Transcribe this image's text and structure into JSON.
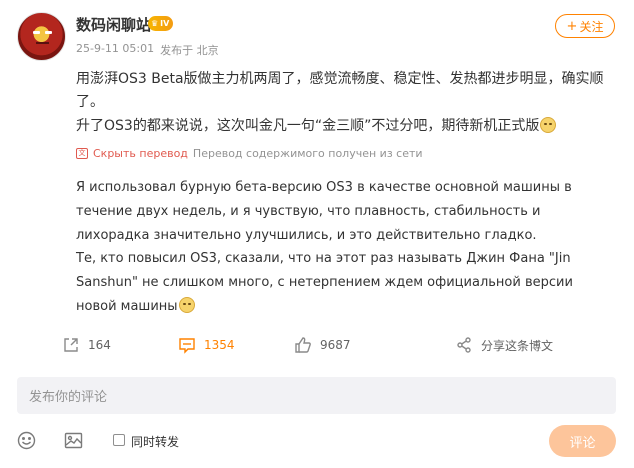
{
  "author": {
    "name": "数码闲聊站",
    "level_badge": "IV"
  },
  "meta": {
    "timestamp": "25-9-11 05:01",
    "source": "发布于 北京"
  },
  "follow_button": {
    "icon": "+",
    "label": "关注"
  },
  "post": {
    "line1": "用澎湃OS3 Beta版做主力机两周了，感觉流畅度、稳定性、发热都进步明显，确实顺了。",
    "line2": "升了OS3的都来说说，这次叫金凡一句“金三顺”不过分吧，期待新机正式版"
  },
  "translation": {
    "hide_label": "Скрыть перевод",
    "status": "Перевод содержимого получен из сети",
    "text1": "Я использовал бурную бета-версию OS3 в качестве основной машины в течение двух недель, и я чувствую, что плавность, стабильность и лихорадка значительно улучшились, и это действительно гладко.",
    "text2": "Те, кто повысил OS3, сказали, что на этот раз называть Джин Фана \"Jin Sanshun\" не слишком много, с нетерпением ждем официальной версии новой машины"
  },
  "actions": {
    "repost_count": "164",
    "comment_count": "1354",
    "like_count": "9687",
    "share_label": "分享这条博文"
  },
  "comment": {
    "placeholder": "发布你的评论",
    "repost_checkbox_label": "同时转发",
    "submit_label": "评论"
  },
  "colors": {
    "accent": "#ff8200",
    "translate_link": "#e05a4f",
    "submit_disabled": "#fdc59b"
  }
}
